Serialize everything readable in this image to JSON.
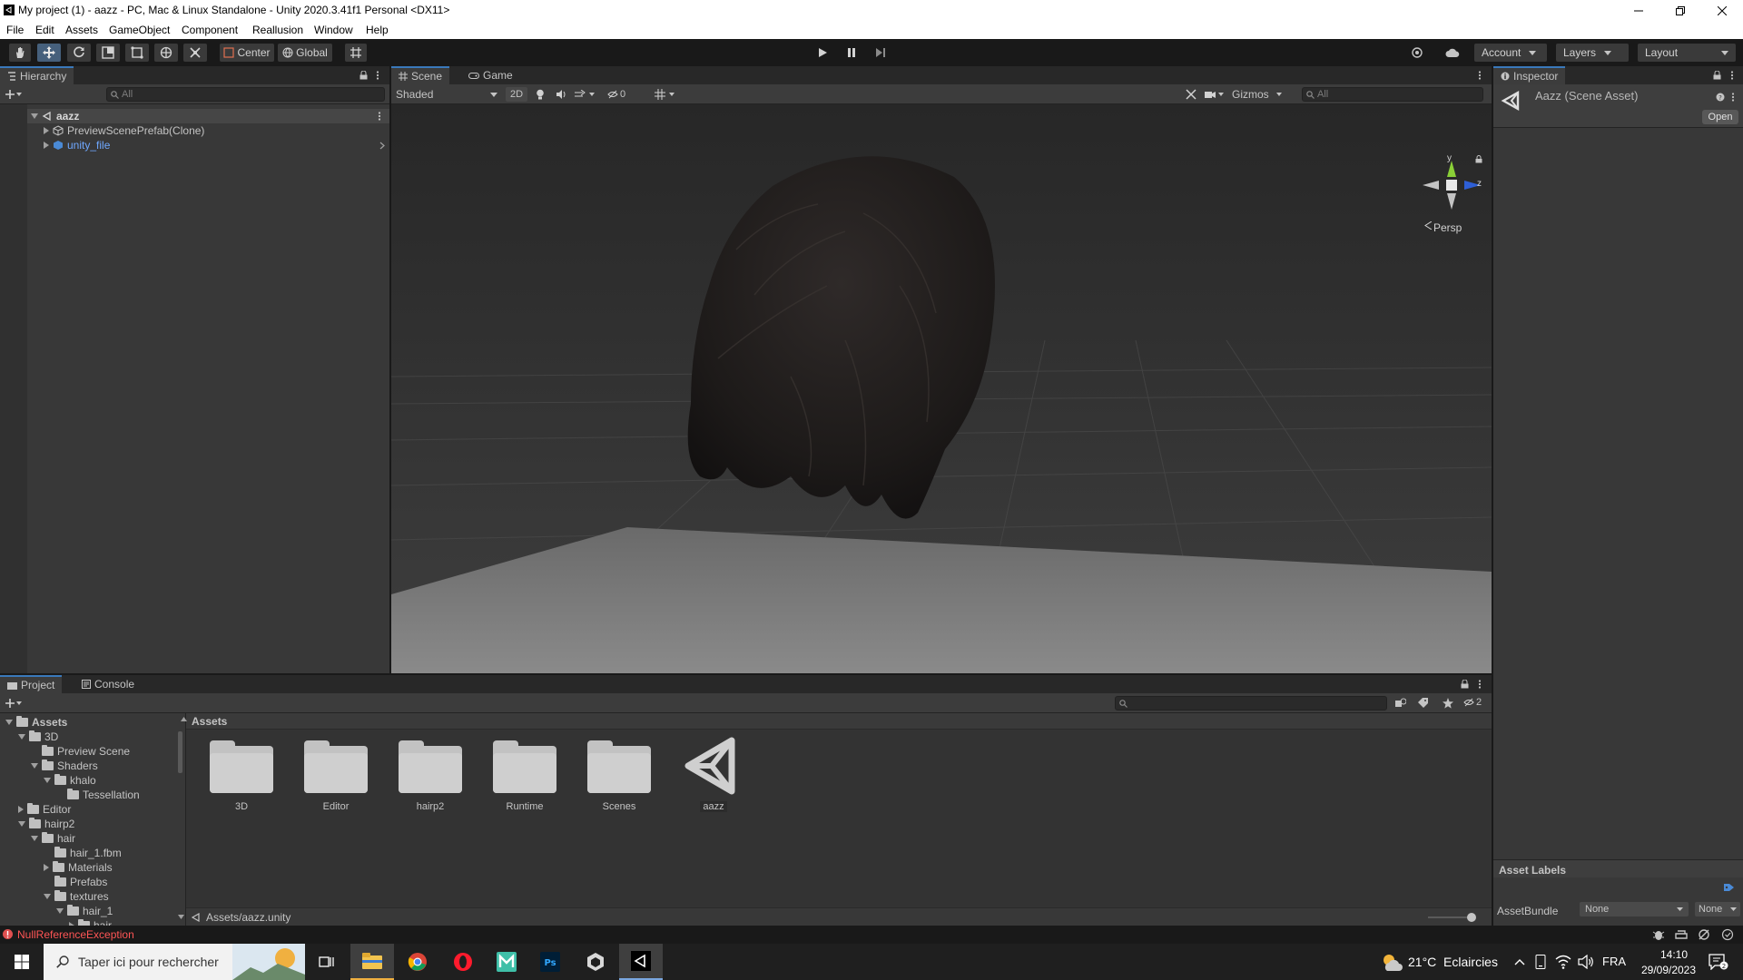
{
  "window": {
    "title": "My project (1) - aazz - PC, Mac & Linux Standalone - Unity 2020.3.41f1 Personal <DX11>"
  },
  "menu": [
    "File",
    "Edit",
    "Assets",
    "GameObject",
    "Component",
    "Reallusion",
    "Window",
    "Help"
  ],
  "toolbar": {
    "pivot_label": "Center",
    "space_label": "Global",
    "account_label": "Account",
    "layers_label": "Layers",
    "layout_label": "Layout"
  },
  "hierarchy": {
    "tab_label": "Hierarchy",
    "search_placeholder": "All",
    "scene_name": "aazz",
    "items": [
      {
        "label": "PreviewScenePrefab(Clone)"
      },
      {
        "label": "unity_file"
      }
    ]
  },
  "scene": {
    "tabs": [
      "Scene",
      "Game"
    ],
    "shading_mode": "Shaded",
    "mode_2d": "2D",
    "hidden_count": "0",
    "gizmos_label": "Gizmos",
    "search_placeholder": "All",
    "gizmo": {
      "y": "y",
      "z": "z",
      "persp": "Persp"
    }
  },
  "inspector": {
    "tab_label": "Inspector",
    "asset_title": "Aazz (Scene Asset)",
    "open_label": "Open",
    "asset_labels_heading": "Asset Labels",
    "assetbundle_label": "AssetBundle",
    "assetbundle_value": "None",
    "variant_value": "None"
  },
  "project": {
    "tabs": [
      "Project",
      "Console"
    ],
    "hidden_count": "2",
    "breadcrumb": "Assets",
    "path": "Assets/aazz.unity",
    "tree": [
      {
        "label": "Assets",
        "level": 0,
        "open": true
      },
      {
        "label": "3D",
        "level": 1,
        "open": true
      },
      {
        "label": "Preview Scene",
        "level": 2,
        "open": null
      },
      {
        "label": "Shaders",
        "level": 2,
        "open": true
      },
      {
        "label": "khalo",
        "level": 3,
        "open": true
      },
      {
        "label": "Tessellation",
        "level": 4,
        "open": null
      },
      {
        "label": "Editor",
        "level": 1,
        "open": false
      },
      {
        "label": "hairp2",
        "level": 1,
        "open": true
      },
      {
        "label": "hair",
        "level": 2,
        "open": true
      },
      {
        "label": "hair_1.fbm",
        "level": 3,
        "open": null
      },
      {
        "label": "Materials",
        "level": 3,
        "open": false
      },
      {
        "label": "Prefabs",
        "level": 3,
        "open": null
      },
      {
        "label": "textures",
        "level": 3,
        "open": true
      },
      {
        "label": "hair_1",
        "level": 4,
        "open": true
      },
      {
        "label": "hair",
        "level": 5,
        "open": false
      }
    ],
    "assets": [
      {
        "label": "3D",
        "kind": "folder"
      },
      {
        "label": "Editor",
        "kind": "folder"
      },
      {
        "label": "hairp2",
        "kind": "folder"
      },
      {
        "label": "Runtime",
        "kind": "folder"
      },
      {
        "label": "Scenes",
        "kind": "folder"
      },
      {
        "label": "aazz",
        "kind": "scene"
      }
    ]
  },
  "status": {
    "error": "NullReferenceException"
  },
  "taskbar": {
    "search_placeholder": "Taper ici pour rechercher",
    "weather": "21°C  Eclaircies",
    "language": "FRA",
    "time": "14:10",
    "date": "29/09/2023"
  },
  "colors": {
    "accent": "#3a79bb",
    "error": "#ff5555",
    "link": "#6fa8ff"
  }
}
